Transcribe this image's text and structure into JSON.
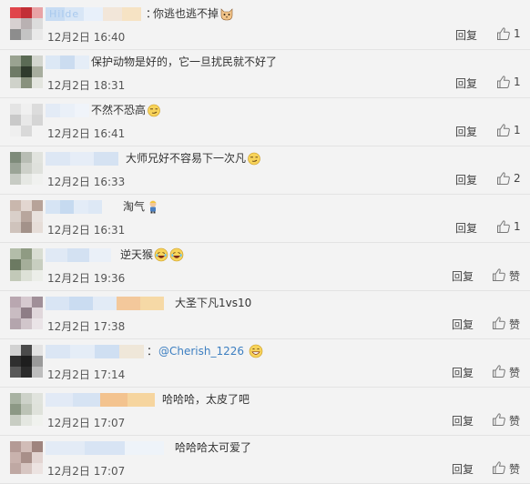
{
  "comments": [
    {
      "colon": "：",
      "text": "你逃也逃不掉",
      "emojis": [
        "cat-emoji"
      ],
      "mention": "",
      "time": "12月2日 16:40",
      "reply": "回复",
      "like": "1",
      "avatar": [
        "#e0454b",
        "#c22f36",
        "#e8a3a6",
        "#d7d0d0",
        "#b9b1b2",
        "#dcdcdc",
        "#8d8d8d",
        "#c4c4c4",
        "#e9e9e9"
      ],
      "name_blocks": [
        "#c7dcf3",
        "#d8e6f6",
        "#e8f0fa",
        "#f2e6d9",
        "#f6e3c4"
      ],
      "name_text": "Hilde"
    },
    {
      "colon": "",
      "text": "保护动物是好的，它一旦扰民就不好了",
      "emojis": [],
      "mention": "",
      "time": "12月2日 18:31",
      "reply": "回复",
      "like": "1",
      "avatar": [
        "#9aa391",
        "#5b6b55",
        "#d3d6cf",
        "#6e7a66",
        "#2f3a2c",
        "#a7ad9e",
        "#cfd2ca",
        "#88917d",
        "#e3e5df"
      ],
      "name_blocks": [
        "#dce8f5",
        "#cbdcf0",
        "#e5edf7"
      ],
      "name_text": ""
    },
    {
      "colon": "",
      "text": "不然不恐高",
      "emojis": [
        "smirk-emoji"
      ],
      "mention": "",
      "time": "12月2日 16:41",
      "reply": "回复",
      "like": "1",
      "avatar": [
        "#e4e4e4",
        "#f0f0f0",
        "#dcdcdc",
        "#c9c9c9",
        "#e8e8e8",
        "#d5d5d5",
        "#efefef",
        "#d9d9d9",
        "#f3f3f3"
      ],
      "name_blocks": [
        "#e3ebf6",
        "#eaf0f8",
        "#f0f4fa"
      ],
      "name_text": ""
    },
    {
      "colon": "",
      "text": "大师兄好不容易下一次凡",
      "emojis": [
        "smirk-emoji"
      ],
      "mention": "",
      "time": "12月2日 16:33",
      "reply": "回复",
      "like": "2",
      "avatar": [
        "#7e8b7a",
        "#b8bdb4",
        "#e1e3de",
        "#9ba497",
        "#cdd0c9",
        "#dfe1dc",
        "#c7cbc4",
        "#e6e8e4",
        "#f0f1ef"
      ],
      "name_blocks": [
        "#dde7f4",
        "#e6edf7",
        "#d5e2f2"
      ],
      "name_text": ""
    },
    {
      "colon": "",
      "text": "淘气",
      "emojis": [
        "boy-emoji"
      ],
      "mention": "",
      "time": "12月2日 16:31",
      "reply": "回复",
      "like": "1",
      "avatar": [
        "#c9b7ad",
        "#e2d6d0",
        "#b7a399",
        "#d9cfc9",
        "#b8a69d",
        "#e8e1dd",
        "#cfc3bc",
        "#a3928a",
        "#e6ddd8"
      ],
      "name_blocks": [
        "#d6e4f4",
        "#c6daf0",
        "#e3ecf7",
        "#dde8f5"
      ],
      "name_text": ""
    },
    {
      "colon": "",
      "text": "逆天猴",
      "emojis": [
        "laugh-emoji",
        "laugh-emoji"
      ],
      "mention": "",
      "time": "12月2日 19:36",
      "reply": "回复",
      "like": "赞",
      "avatar": [
        "#b3bda9",
        "#8f9b83",
        "#d9ddd3",
        "#6c7a62",
        "#a5ae9a",
        "#c8cec0",
        "#c2c9b8",
        "#dde1d7",
        "#eceee9"
      ],
      "name_blocks": [
        "#e0e9f5",
        "#d3e1f2",
        "#eaf0f8"
      ],
      "name_text": ""
    },
    {
      "colon": "",
      "text": "大圣下凡1vs10",
      "emojis": [],
      "mention": "",
      "time": "12月2日 17:38",
      "reply": "回复",
      "like": "赞",
      "avatar": [
        "#b9a7b0",
        "#d6c9cf",
        "#a08f98",
        "#c9bcc2",
        "#8e7d86",
        "#e0d7db",
        "#b4a5ad",
        "#d1c6cb",
        "#eae4e7"
      ],
      "name_blocks": [
        "#d9e5f4",
        "#cadcf1",
        "#e2ebf6",
        "#f3c89b",
        "#f6d9a6"
      ],
      "name_text": ""
    },
    {
      "colon": "：",
      "text": "",
      "emojis": [
        "grin-emoji"
      ],
      "mention": "@Cherish_1226",
      "time": "12月2日 17:14",
      "reply": "回复",
      "like": "赞",
      "avatar": [
        "#d2d2d2",
        "#4b4b4b",
        "#e3e3e3",
        "#2f2f2f",
        "#1e1e1e",
        "#9a9a9a",
        "#585858",
        "#2b2b2b",
        "#bdbdbd"
      ],
      "name_blocks": [
        "#dbe6f4",
        "#e5edf7",
        "#cfdff2",
        "#efe7d9"
      ],
      "name_text": ""
    },
    {
      "colon": "",
      "text": "哈哈哈，太皮了吧",
      "emojis": [],
      "mention": "",
      "time": "12月2日 17:07",
      "reply": "回复",
      "like": "赞",
      "avatar": [
        "#a8b2a2",
        "#cdd2c9",
        "#e0e3dd",
        "#8c9885",
        "#bcc3b6",
        "#dfe2db",
        "#c8cdc3",
        "#e4e7e1",
        "#f0f2ee"
      ],
      "name_blocks": [
        "#e2eaf6",
        "#d6e3f3",
        "#f3c38f",
        "#f6d59f"
      ],
      "name_text": ""
    },
    {
      "colon": "",
      "text": "哈哈哈太可爱了",
      "emojis": [],
      "mention": "",
      "time": "12月2日 17:07",
      "reply": "回复",
      "like": "赞",
      "avatar": [
        "#b49a95",
        "#d1bcb7",
        "#9f847e",
        "#c9b2ad",
        "#a88f89",
        "#e2d4d1",
        "#bfa8a3",
        "#d7c6c2",
        "#ece3e1"
      ],
      "name_blocks": [
        "#e3ebf6",
        "#d8e4f4",
        "#eef3f9"
      ],
      "name_text": ""
    }
  ]
}
